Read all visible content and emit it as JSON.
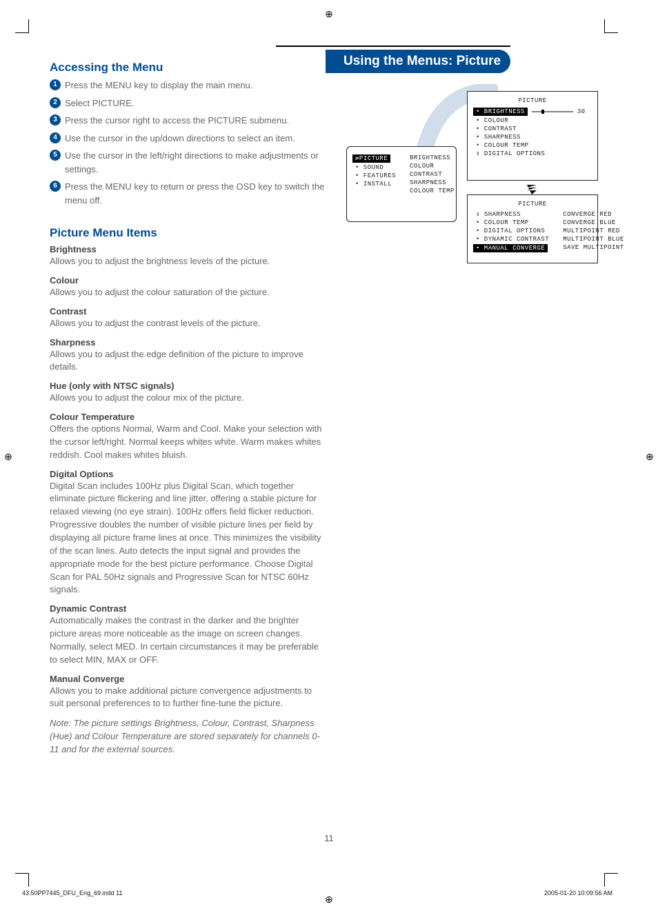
{
  "banner": "Using the Menus: Picture",
  "section1_title": "Accessing the Menu",
  "steps": [
    "Press the MENU key to display the main menu.",
    "Select PICTURE.",
    "Press the cursor right to access the PICTURE submenu.",
    "Use the cursor in the up/down directions to select an item.",
    "Use the cursor in the left/right directions to make adjustments or settings.",
    "Press the MENU key to return or press the OSD key to switch the menu off."
  ],
  "section2_title": "Picture Menu Items",
  "items": [
    {
      "h": "Brightness",
      "p": "Allows you to adjust the brightness levels of the picture."
    },
    {
      "h": "Colour",
      "p": "Allows you to adjust the colour saturation of the picture."
    },
    {
      "h": "Contrast",
      "p": "Allows you to adjust the contrast levels of the picture."
    },
    {
      "h": "Sharpness",
      "p": "Allows you to adjust the edge definition of the picture to improve details."
    },
    {
      "h": "Hue (only with NTSC signals)",
      "p": "Allows you to adjust the colour mix of the picture."
    },
    {
      "h": "Colour Temperature",
      "p": "Offers the options Normal, Warm and Cool. Make your selection with the cursor left/right. Normal keeps whites white. Warm makes whites reddish. Cool makes whites bluish."
    },
    {
      "h": "Digital Options",
      "p": "Digital Scan includes 100Hz plus Digital Scan, which together eliminate picture flickering and line jitter, offering a stable picture for relaxed viewing (no eye strain). 100Hz offers field flicker reduction. Progressive doubles the number of visible picture lines per field by displaying all picture frame lines at once. This minimizes the visibility of the scan lines. Auto detects the input signal and provides the appropriate mode for the best picture performance. Choose Digital Scan for PAL 50Hz signals and Progressive Scan for NTSC 60Hz signals."
    },
    {
      "h": "Dynamic Contrast",
      "p": "Automatically makes the contrast in the darker and the brighter picture areas more noticeable as the image on screen changes. Normally, select MED. In certain circumstances it may be preferable to select MIN, MAX or OFF."
    },
    {
      "h": "Manual Converge",
      "p": "Allows you to make additional picture convergence adjustments to suit personal preferences to to further fine-tune the picture."
    }
  ],
  "note": "Note: The picture settings Brightness, Colour, Contrast, Sharpness (Hue) and Colour Temperature are stored separately for channels 0-11 and for the external sources.",
  "osd_main": {
    "selected": "⇄PICTURE",
    "rows_left": [
      "• SOUND",
      "• FEATURES",
      "• INSTALL"
    ],
    "rows_right": [
      "BRIGHTNESS",
      "COLOUR",
      "CONTRAST",
      "SHARPNESS",
      "COLOUR TEMP"
    ]
  },
  "osd_pic1": {
    "title": "PICTURE",
    "selected": "• BRIGHTNESS",
    "value": "30",
    "rows": [
      "• COLOUR",
      "• CONTRAST",
      "• SHARPNESS",
      "• COLOUR TEMP",
      "⇕ DIGITAL OPTIONS"
    ]
  },
  "osd_pic2": {
    "title": "PICTURE",
    "left": [
      "⇕ SHARPNESS",
      "• COLOUR TEMP",
      "• DIGITAL OPTIONS",
      "• DYNAMIC CONTRAST"
    ],
    "selected_left": "• MANUAL CONVERGE",
    "right": [
      "CONVERGE RED",
      "CONVERGE BLUE",
      "MULTIPOINT RED",
      "MULTIPOINT BLUE",
      "SAVE MULTIPOINT"
    ]
  },
  "page_number": "11",
  "imprint_left": "43.50PP7445_DFU_Eng_69.indd   11",
  "imprint_right": "2005-01-20   10:09:56 AM"
}
